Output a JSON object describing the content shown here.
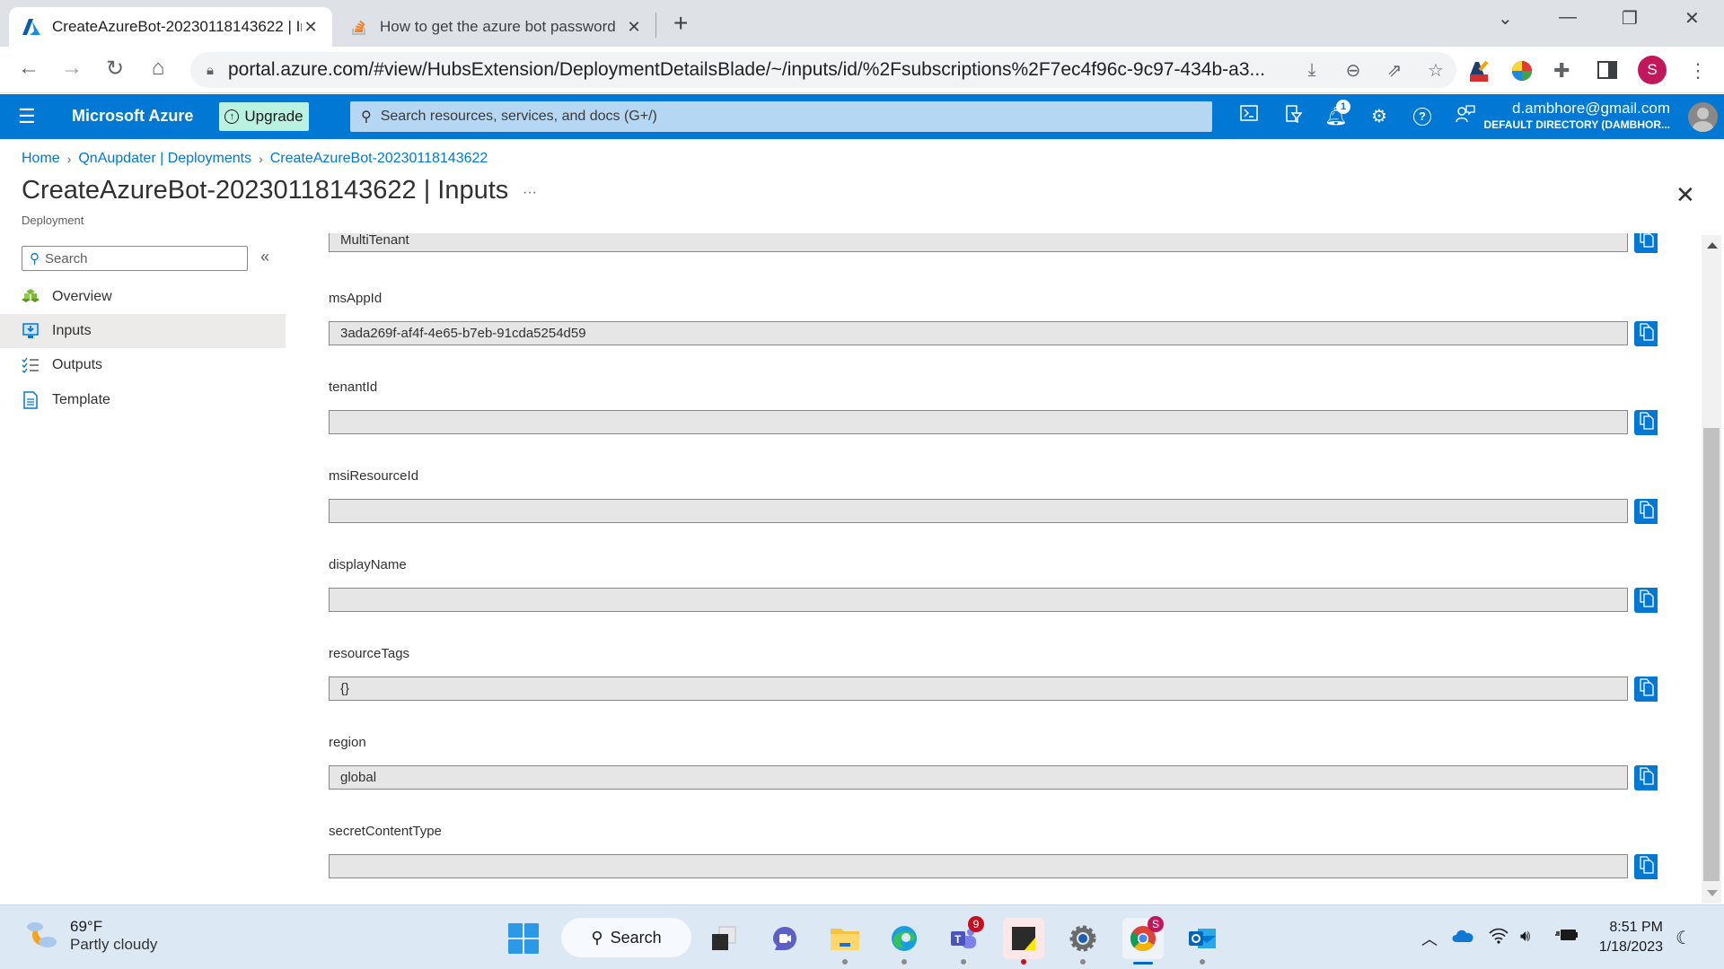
{
  "browser": {
    "tabs": [
      {
        "title": "CreateAzureBot-20230118143622 | Inputs",
        "icon": "azure-logo-icon",
        "active": true
      },
      {
        "title": "How to get the azure bot password",
        "icon": "stackoverflow-icon",
        "active": false
      }
    ],
    "url": "portal.azure.com/#view/HubsExtension/DeploymentDetailsBlade/~/inputs/id/%2Fsubscriptions%2F7ec4f96c-9c97-434b-a3...",
    "profile_initial": "S"
  },
  "azure": {
    "brand": "Microsoft Azure",
    "upgrade_label": "Upgrade",
    "search_placeholder": "Search resources, services, and docs (G+/)",
    "notifications_count": "1",
    "user_email": "d.ambhore@gmail.com",
    "user_directory": "DEFAULT DIRECTORY (DAMBHOR..."
  },
  "breadcrumb": [
    {
      "label": "Home"
    },
    {
      "label": "QnAupdater | Deployments"
    },
    {
      "label": "CreateAzureBot-20230118143622"
    }
  ],
  "page": {
    "title": "CreateAzureBot-20230118143622",
    "title_section": " | Inputs",
    "more": "···",
    "subtitle": "Deployment"
  },
  "left_menu": {
    "search_placeholder": "Search",
    "collapse": "«",
    "items": [
      {
        "label": "Overview",
        "icon": "overview-icon",
        "selected": false
      },
      {
        "label": "Inputs",
        "icon": "inputs-icon",
        "selected": true
      },
      {
        "label": "Outputs",
        "icon": "outputs-icon",
        "selected": false
      },
      {
        "label": "Template",
        "icon": "template-icon",
        "selected": false
      }
    ]
  },
  "fields": [
    {
      "label": "",
      "value": "MultiTenant"
    },
    {
      "label": "msAppId",
      "value": "3ada269f-af4f-4e65-b7eb-91cda5254d59"
    },
    {
      "label": "tenantId",
      "value": ""
    },
    {
      "label": "msiResourceId",
      "value": ""
    },
    {
      "label": "displayName",
      "value": ""
    },
    {
      "label": "resourceTags",
      "value": "{}"
    },
    {
      "label": "region",
      "value": "global"
    },
    {
      "label": "secretContentType",
      "value": ""
    }
  ],
  "taskbar": {
    "weather_temp": "69°F",
    "weather_desc": "Partly cloudy",
    "search_label": "Search",
    "teams_badge": "9",
    "chrome_badge": "S",
    "time": "8:51 PM",
    "date": "1/18/2023"
  },
  "colors": {
    "azure_blue": "#0078d4",
    "upgrade_bg": "#b9f2e0"
  }
}
